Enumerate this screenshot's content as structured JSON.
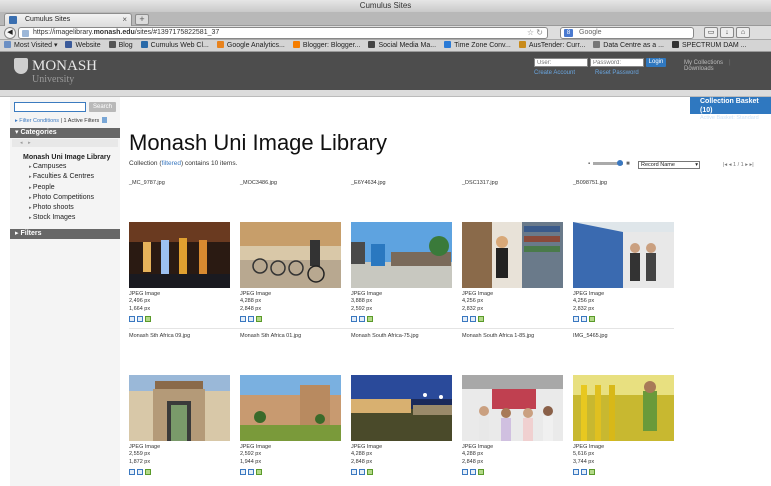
{
  "browser": {
    "window_title": "Cumulus Sites",
    "tab_title": "Cumulus Sites",
    "url_prefix": "https://imagelibrary.",
    "url_domain": "monash.edu",
    "url_path": "/sites/#1397175822581_37",
    "search_placeholder": "Google",
    "new_tab": "+",
    "bookmarks": [
      {
        "label": "Most Visited ▾",
        "color": "#6b8fc4"
      },
      {
        "label": "Website",
        "color": "#3a5a9a"
      },
      {
        "label": "Blog",
        "color": "#555555"
      },
      {
        "label": "Cumulus Web Cl...",
        "color": "#2a6aa8"
      },
      {
        "label": "Google Analytics...",
        "color": "#e8831e"
      },
      {
        "label": "Blogger: Blogger...",
        "color": "#f57d00"
      },
      {
        "label": "Social Media Ma...",
        "color": "#444444"
      },
      {
        "label": "Time Zone Conv...",
        "color": "#2a7ad6"
      },
      {
        "label": "AusTender: Curr...",
        "color": "#c88a1a"
      },
      {
        "label": "Data Centre as a ...",
        "color": "#777777"
      },
      {
        "label": "SPECTRUM DAM ...",
        "color": "#333333"
      }
    ]
  },
  "site": {
    "logo_name": "MONASH",
    "logo_sub": "University",
    "login_user_placeholder": "User:",
    "login_password_placeholder": "Password:",
    "login_button": "Login",
    "create_account": "Create Account",
    "reset_password": "Reset Password",
    "my_collections": "My Collections",
    "downloads": "Downloads"
  },
  "sidebar": {
    "search_button": "Search",
    "filter_conditions": "▸ Filter Conditions",
    "active_filters": " | 1 Active Filters",
    "categories_heading": "Categories",
    "category_root": "Monash Uni Image Library",
    "categories": [
      "Campuses",
      "Faculties & Centres",
      "People",
      "Photo Competitions",
      "Photo shoots",
      "Stock Images"
    ],
    "filters_heading": "Filters"
  },
  "basket": {
    "title": "Collection Basket (10)",
    "subtitle": "Active Basket: Standard"
  },
  "main": {
    "title": "Monash Uni Image Library",
    "info_prefix": "Collection (",
    "info_link": "filtered",
    "info_suffix": ") contains 10 items.",
    "sort_value": "Record Name",
    "pager": "|◂ ◂  1 / 1  ▸ ▸|"
  },
  "items": [
    {
      "name": "_MC_9787.jpg",
      "type": "JPEG Image",
      "w": "2,496 px",
      "h": "1,664 px"
    },
    {
      "name": "_MOC3486.jpg",
      "type": "JPEG Image",
      "w": "4,288 px",
      "h": "2,848 px"
    },
    {
      "name": "_E6Y4634.jpg",
      "type": "JPEG Image",
      "w": "3,888 px",
      "h": "2,592 px"
    },
    {
      "name": "_DSC1317.jpg",
      "type": "JPEG Image",
      "w": "4,256 px",
      "h": "2,832 px"
    },
    {
      "name": "_B098751.jpg",
      "type": "JPEG Image",
      "w": "4,256 px",
      "h": "2,832 px"
    },
    {
      "name": "Monash Sth Africa 09.jpg",
      "type": "JPEG Image",
      "w": "2,559 px",
      "h": "1,872 px"
    },
    {
      "name": "Monash Sth Africa 01.jpg",
      "type": "JPEG Image",
      "w": "2,592 px",
      "h": "1,944 px"
    },
    {
      "name": "Monash South Africa-75.jpg",
      "type": "JPEG Image",
      "w": "4,288 px",
      "h": "2,848 px"
    },
    {
      "name": "Monash South Africa 1-85.jpg",
      "type": "JPEG Image",
      "w": "4,288 px",
      "h": "2,848 px"
    },
    {
      "name": "IMG_5465.jpg",
      "type": "JPEG Image",
      "w": "5,616 px",
      "h": "3,744 px"
    }
  ]
}
